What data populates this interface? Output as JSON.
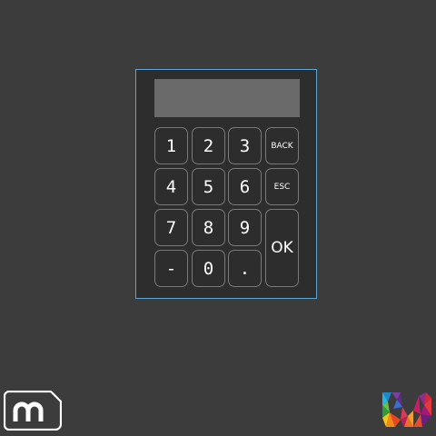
{
  "display": {
    "value": ""
  },
  "keys": {
    "k1": "1",
    "k2": "2",
    "k3": "3",
    "back": "BACK",
    "k4": "4",
    "k5": "5",
    "k6": "6",
    "esc": "ESC",
    "k7": "7",
    "k8": "8",
    "k9": "9",
    "ok": "OK",
    "minus": "-",
    "k0": "0",
    "dot": "."
  },
  "icons": {
    "left_logo": "m-logo-icon",
    "right_logo": "colorful-w-logo-icon"
  },
  "colors": {
    "background": "#3c3c3c",
    "panel": "#2d2d2d",
    "panel_border": "#5aa6d6",
    "display": "#6a6a6a",
    "key_border": "#7a7a7a",
    "key_text": "#ffffff"
  }
}
